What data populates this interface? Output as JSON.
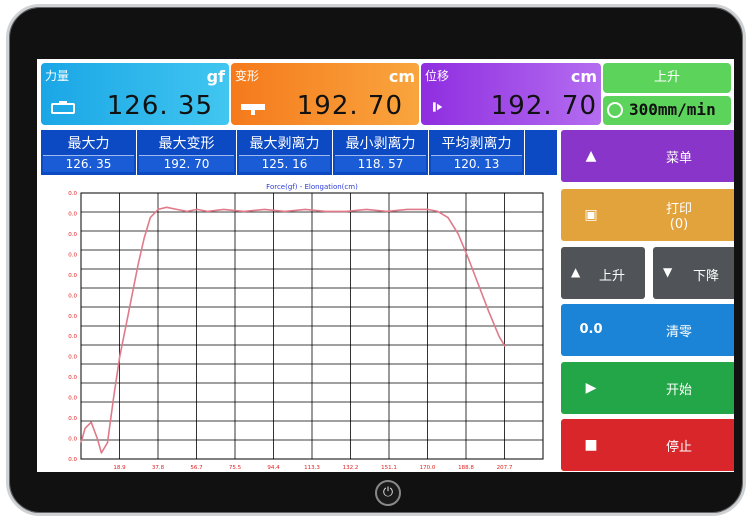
{
  "panels": {
    "force": {
      "label": "力量",
      "unit": "gf",
      "value": "126. 35"
    },
    "deform": {
      "label": "变形",
      "unit": "cm",
      "value": "192. 70"
    },
    "disp": {
      "label": "位移",
      "unit": "cm",
      "value": "192. 70"
    }
  },
  "top_controls": {
    "up_label": "上升",
    "speed": "300mm/min"
  },
  "stats": {
    "headers": [
      "最大力",
      "最大变形",
      "最大剥离力",
      "最小剥离力",
      "平均剥离力"
    ],
    "values": [
      "126. 35",
      "192. 70",
      "125. 16",
      "118. 57",
      "120. 13"
    ]
  },
  "buttons": {
    "menu": "菜单",
    "print": "打印",
    "print_count": "(0)",
    "up": "上升",
    "down": "下降",
    "zero": "清零",
    "zero_icon_text": "0.0",
    "start": "开始",
    "stop": "停止"
  },
  "colors": {
    "force_panel": "#1aa6e6",
    "deform_panel": "#f57a1c",
    "disp_panel": "#8f2de0",
    "speed_green": "#5cd45b",
    "stats_blue": "#0c4ac4",
    "menu": "#8a35c9",
    "print": "#e2a23c",
    "zero": "#1b84d6",
    "start": "#23a647",
    "stop": "#d9262b",
    "curve": "#e07a8a"
  },
  "chart_data": {
    "type": "line",
    "title": "Force(gf) - Elongation(cm)",
    "xlabel": "",
    "ylabel": "",
    "x_ticks": [
      "18.9",
      "37.8",
      "56.7",
      "75.5",
      "94.4",
      "113.3",
      "132.2",
      "151.1",
      "170.0",
      "188.8",
      "207.7"
    ],
    "y_ticks": [
      "0.0",
      "0.0",
      "0.0",
      "0.0",
      "0.0",
      "0.0",
      "0.0",
      "0.0",
      "0.0",
      "0.0",
      "0.0",
      "0.0",
      "0.0",
      "0.0"
    ],
    "xlim": [
      0,
      226.6
    ],
    "ylim": [
      0,
      130
    ],
    "grid": true,
    "series": [
      {
        "x": [
          0,
          2,
          5,
          8,
          10,
          13,
          16,
          19,
          22,
          25,
          28,
          31,
          34,
          37.8,
          42,
          47,
          52,
          57,
          62,
          70,
          80,
          90,
          100,
          110,
          120,
          130,
          140,
          150,
          160,
          170,
          175,
          180,
          185,
          190,
          195,
          200,
          205,
          208
        ],
        "y": [
          8,
          15,
          18,
          10,
          3,
          8,
          30,
          50,
          65,
          80,
          95,
          108,
          118,
          122,
          123,
          122,
          121,
          122,
          121,
          122,
          121,
          122,
          121,
          122,
          121,
          121,
          122,
          121,
          122,
          122,
          121,
          118,
          110,
          98,
          85,
          72,
          60,
          55
        ]
      }
    ]
  }
}
